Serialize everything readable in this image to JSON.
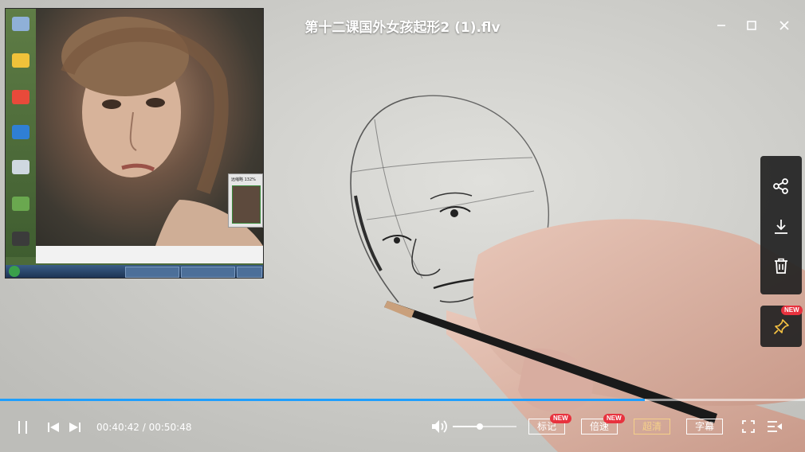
{
  "window": {
    "title": "第十二课国外女孩起形2 (1).flv",
    "minimize_icon": "minimize-icon",
    "maximize_icon": "maximize-icon",
    "close_icon": "close-icon"
  },
  "video": {
    "embedded_screen": {
      "zoom_label": "远缩略 132%"
    }
  },
  "side_panel": {
    "items": [
      {
        "icon": "share-icon"
      },
      {
        "icon": "download-icon"
      },
      {
        "icon": "delete-icon"
      }
    ],
    "pin": {
      "icon": "pin-icon",
      "badge": "NEW"
    }
  },
  "playback": {
    "current_time": "00:40:42",
    "total_time": "00:50:48",
    "time_display": "00:40:42 / 00:50:48",
    "progress": 0.801,
    "volume": 0.42
  },
  "controls": {
    "mark_label": "标记",
    "mark_badge": "NEW",
    "speed_label": "倍速",
    "speed_badge": "NEW",
    "quality_label": "超清",
    "subtitle_label": "字幕",
    "accent_color": "#1e9fff",
    "quality_color": "#f5d08a"
  }
}
